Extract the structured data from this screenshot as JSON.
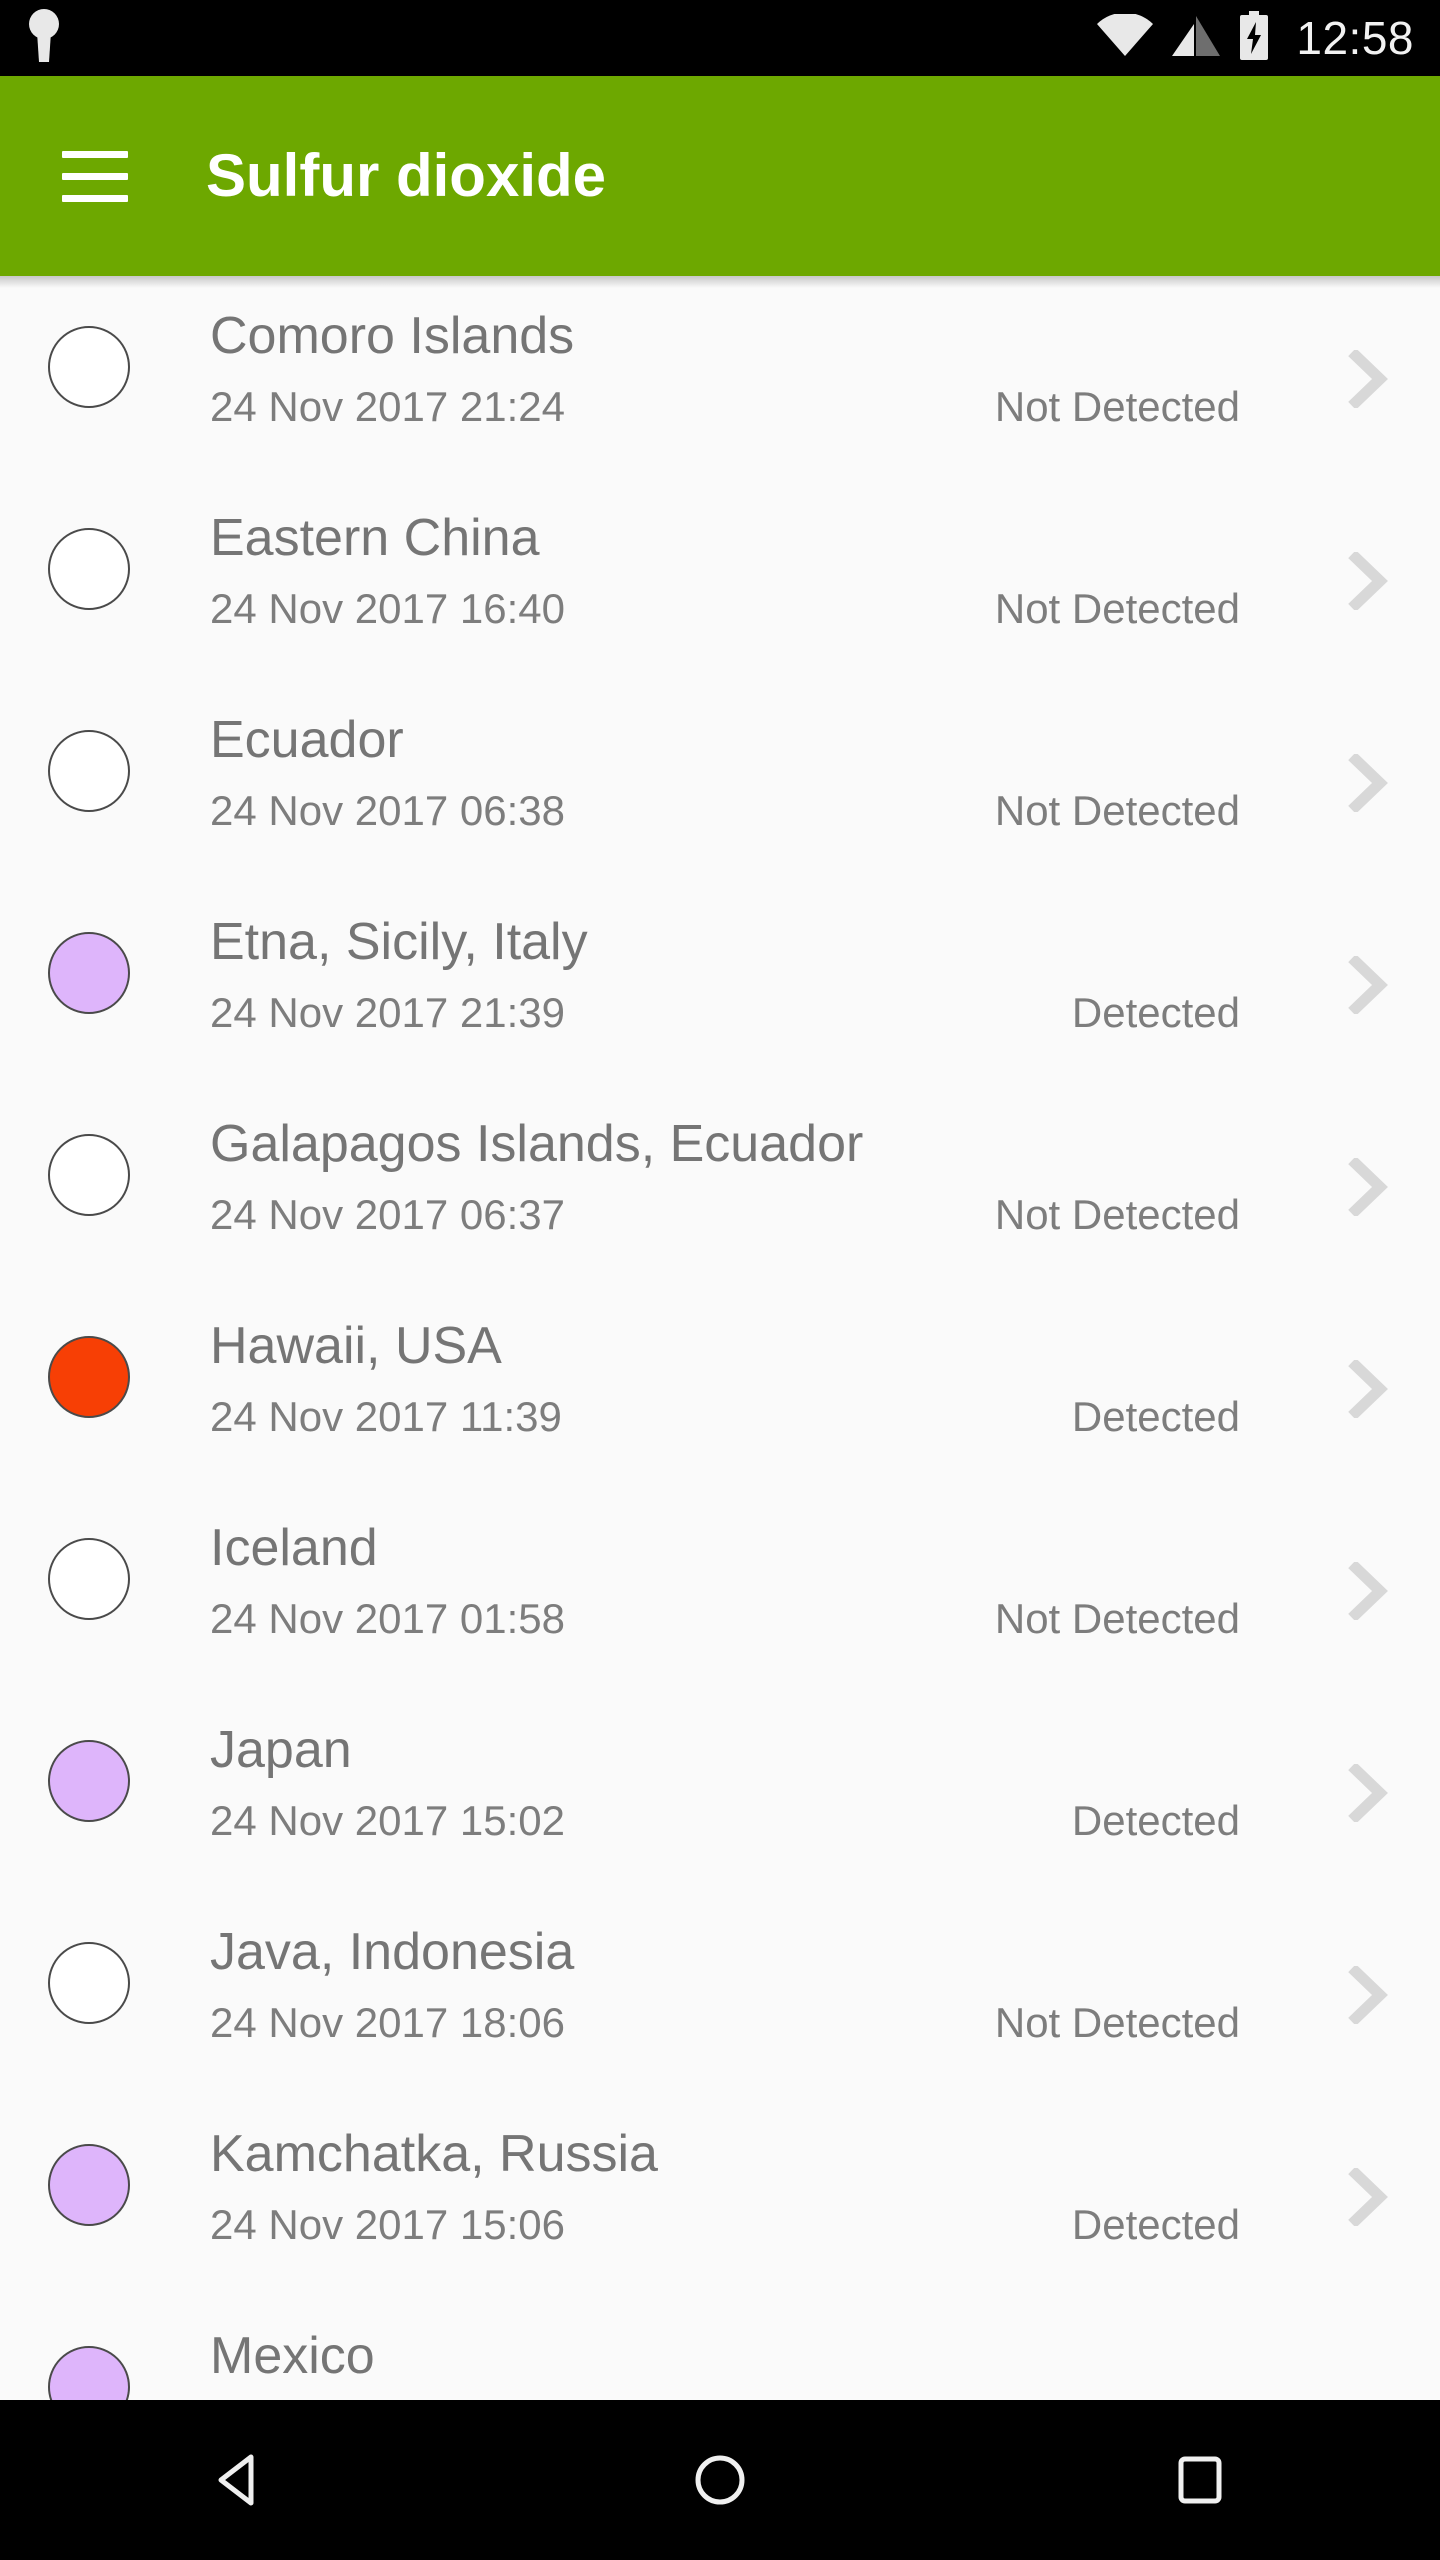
{
  "status_bar": {
    "time": "12:58",
    "icons": [
      "keyhole-icon",
      "wifi-icon",
      "cellular-signal-icon",
      "battery-charging-icon"
    ]
  },
  "app_bar": {
    "title": "Sulfur dioxide",
    "menu_icon": "hamburger-menu-icon",
    "background_color": "#6DA800",
    "title_color": "#FFFFFF"
  },
  "colors": {
    "dot_detected_purple": "#DEB5FB",
    "dot_detected_orange": "#F73F05",
    "dot_not_detected": "#FFFFFF",
    "dot_border": "#4A4A4A",
    "page_background": "#FAFAFA",
    "primary_text": "#757575",
    "secondary_text": "#7D7D7D",
    "chevron": "#D8D8D8"
  },
  "list": {
    "items": [
      {
        "name": "Comoro Islands",
        "date": "24 Nov 2017 21:24",
        "status": "Not Detected",
        "dot_color": "#FFFFFF"
      },
      {
        "name": "Eastern China",
        "date": "24 Nov 2017 16:40",
        "status": "Not Detected",
        "dot_color": "#FFFFFF"
      },
      {
        "name": "Ecuador",
        "date": "24 Nov 2017 06:38",
        "status": "Not Detected",
        "dot_color": "#FFFFFF"
      },
      {
        "name": "Etna, Sicily, Italy",
        "date": "24 Nov 2017 21:39",
        "status": "Detected",
        "dot_color": "#DEB5FB"
      },
      {
        "name": "Galapagos Islands, Ecuador",
        "date": "24 Nov 2017 06:37",
        "status": "Not Detected",
        "dot_color": "#FFFFFF"
      },
      {
        "name": "Hawaii, USA",
        "date": "24 Nov 2017 11:39",
        "status": "Detected",
        "dot_color": "#F73F05"
      },
      {
        "name": "Iceland",
        "date": "24 Nov 2017 01:58",
        "status": "Not Detected",
        "dot_color": "#FFFFFF"
      },
      {
        "name": "Japan",
        "date": "24 Nov 2017 15:02",
        "status": "Detected",
        "dot_color": "#DEB5FB"
      },
      {
        "name": "Java, Indonesia",
        "date": "24 Nov 2017 18:06",
        "status": "Not Detected",
        "dot_color": "#FFFFFF"
      },
      {
        "name": "Kamchatka, Russia",
        "date": "24 Nov 2017 15:06",
        "status": "Detected",
        "dot_color": "#DEB5FB"
      },
      {
        "name": "Mexico",
        "date": "",
        "status": "",
        "dot_color": "#DEB5FB"
      }
    ]
  },
  "nav_bar": {
    "back_icon": "back-triangle-icon",
    "home_icon": "home-circle-icon",
    "recents_icon": "recents-square-icon"
  }
}
